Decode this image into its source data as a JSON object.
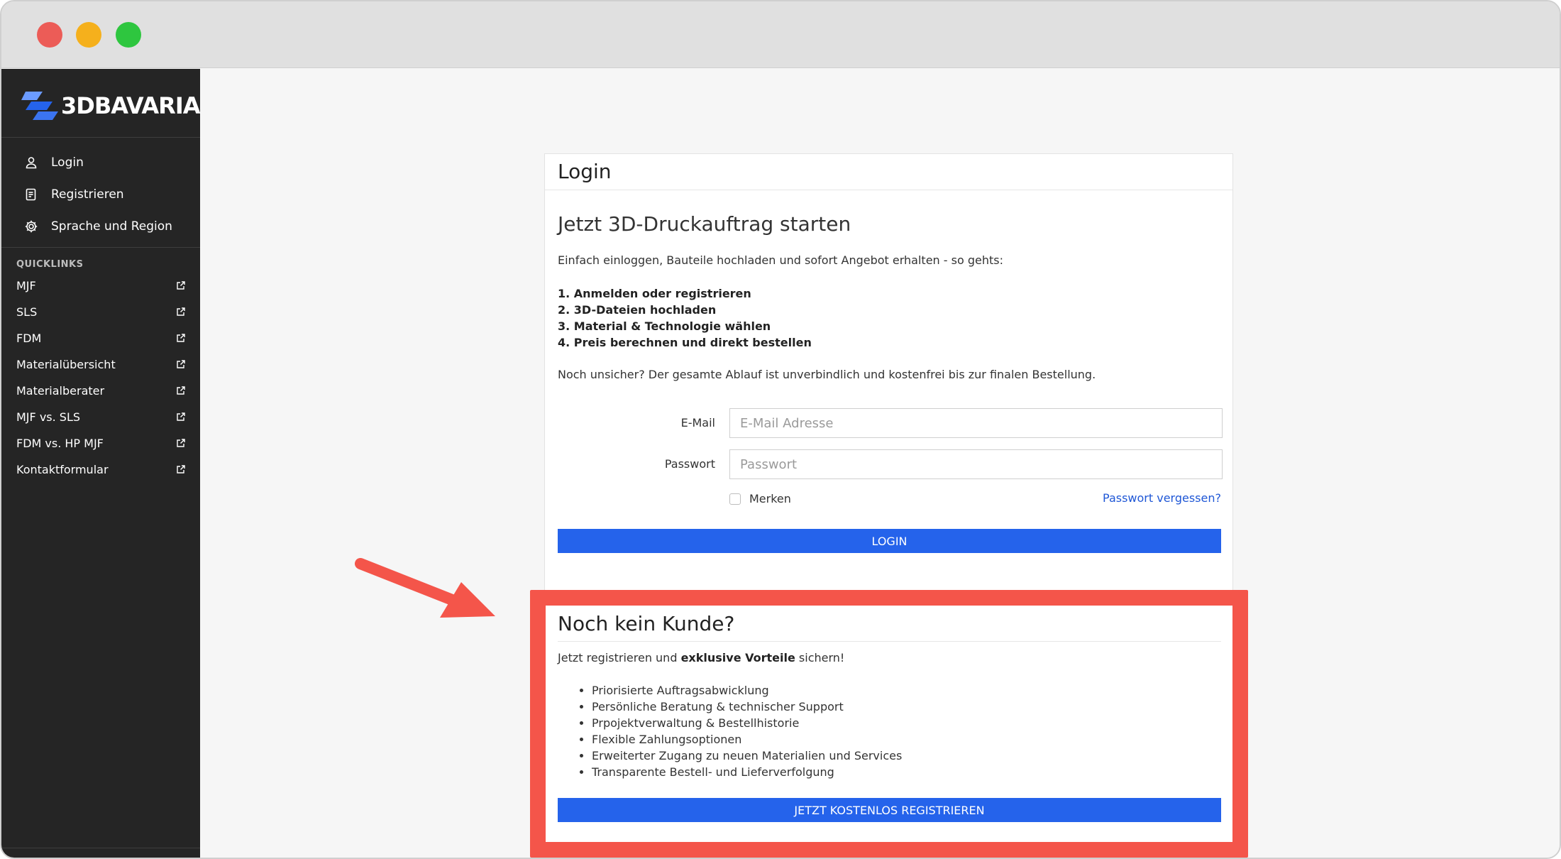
{
  "window": {
    "controls": [
      "close",
      "minimize",
      "maximize"
    ]
  },
  "brand": {
    "name": "3DBAVARIA",
    "accent_color": "#2563eb"
  },
  "sidebar": {
    "nav": [
      {
        "label": "Login",
        "icon": "user-icon"
      },
      {
        "label": "Registrieren",
        "icon": "document-icon"
      },
      {
        "label": "Sprache und Region",
        "icon": "gear-icon"
      }
    ],
    "quicklinks_title": "QUICKLINKS",
    "quicklinks": [
      {
        "label": "MJF",
        "icon": "external-link-icon"
      },
      {
        "label": "SLS",
        "icon": "external-link-icon"
      },
      {
        "label": "FDM",
        "icon": "external-link-icon"
      },
      {
        "label": "Materialübersicht",
        "icon": "external-link-icon"
      },
      {
        "label": "Materialberater",
        "icon": "external-link-icon"
      },
      {
        "label": "MJF vs. SLS",
        "icon": "external-link-icon"
      },
      {
        "label": "FDM vs. HP MJF",
        "icon": "external-link-icon"
      },
      {
        "label": "Kontaktformular",
        "icon": "external-link-icon"
      }
    ]
  },
  "login": {
    "header": "Login",
    "title": "Jetzt 3D-Druckauftrag starten",
    "intro": "Einfach einloggen, Bauteile hochladen und sofort Angebot erhalten - so gehts:",
    "steps": [
      "1. Anmelden oder registrieren",
      "2. 3D-Dateien hochladen",
      "3. Material & Technologie wählen",
      "4. Preis berechnen und direkt bestellen"
    ],
    "note": "Noch unsicher? Der gesamte Ablauf ist unverbindlich und kostenfrei bis zur finalen Bestellung.",
    "email_label": "E-Mail",
    "email_placeholder": "E-Mail Adresse",
    "email_value": "",
    "password_label": "Passwort",
    "password_placeholder": "Passwort",
    "password_value": "",
    "remember_label": "Merken",
    "remember_checked": false,
    "forgot_label": "Passwort vergessen?",
    "submit_label": "LOGIN"
  },
  "register": {
    "title": "Noch kein Kunde?",
    "intro_prefix": "Jetzt registrieren und ",
    "intro_bold": "exklusive Vorteile",
    "intro_suffix": " sichern!",
    "benefits": [
      "Priorisierte Auftragsabwicklung",
      "Persönliche Beratung & technischer Support",
      "Prpojektverwaltung & Bestellhistorie",
      "Flexible Zahlungsoptionen",
      "Erweiterter Zugang zu neuen Materialien und Services",
      "Transparente Bestell- und Lieferverfolgung"
    ],
    "button_label": "JETZT KOSTENLOS REGISTRIEREN"
  },
  "annotation": {
    "color": "#f4554a",
    "type": "arrow-and-highlight"
  }
}
